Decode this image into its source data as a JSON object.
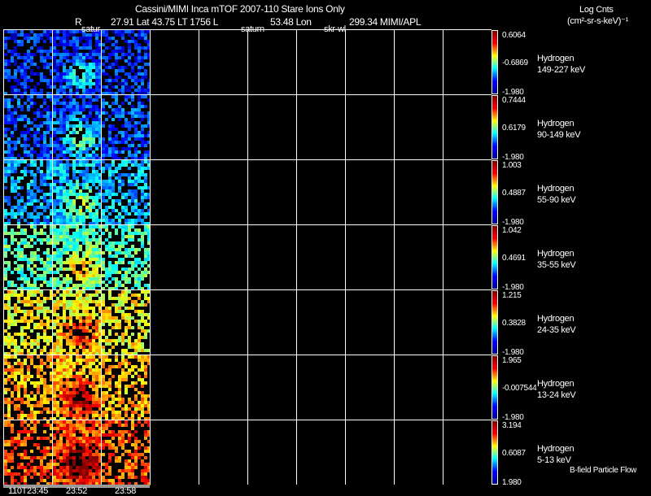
{
  "header": {
    "title": "Cassini/MIMI Inca mTOF  2007-110   Stare   Ions Only",
    "r_label": "R",
    "coords": "27.91 Lat 43.75 LT 1756 L",
    "lon": "53.48 Lon",
    "lon_val": "299.34  MIMI/APL",
    "units_title": "Log Cnts",
    "units": "(cm²-sr-s-keV)⁻¹"
  },
  "column_labels": [
    "satur",
    "saturn",
    "skr-wl"
  ],
  "chart_data": {
    "type": "heatmap",
    "title": "Cassini/MIMI Inca mTOF 2007-110 Stare Ions Only",
    "time_labels": [
      "110T23:45",
      "23:52",
      "23:58"
    ],
    "panels": [
      {
        "species": "Hydrogen",
        "energy": "149-227 keV",
        "max": "0.6064",
        "mid": "-0.6869",
        "min": "-1.980",
        "level": 0.15
      },
      {
        "species": "Hydrogen",
        "energy": "90-149 keV",
        "max": "0.7444",
        "mid": "0.6179",
        "min": "-1.980",
        "level": 0.2
      },
      {
        "species": "Hydrogen",
        "energy": "55-90 keV",
        "max": "1.003",
        "mid": "0.4887",
        "min": "-1.980",
        "level": 0.3
      },
      {
        "species": "Hydrogen",
        "energy": "35-55 keV",
        "max": "1.042",
        "mid": "0.4691",
        "min": "-1.980",
        "level": 0.45
      },
      {
        "species": "Hydrogen",
        "energy": "24-35 keV",
        "max": "1.215",
        "mid": "0.3828",
        "min": "-1.980",
        "level": 0.62
      },
      {
        "species": "Hydrogen",
        "energy": "13-24 keV",
        "max": "1.965",
        "mid": "-0.007544",
        "min": "-1.980",
        "level": 0.7
      },
      {
        "species": "Hydrogen",
        "energy": "5-13 keV",
        "max": "3.194",
        "mid": "0.6087",
        "min": "1.980",
        "level": 0.8
      }
    ]
  },
  "footer": {
    "legend": "B-field Particle Flow"
  }
}
